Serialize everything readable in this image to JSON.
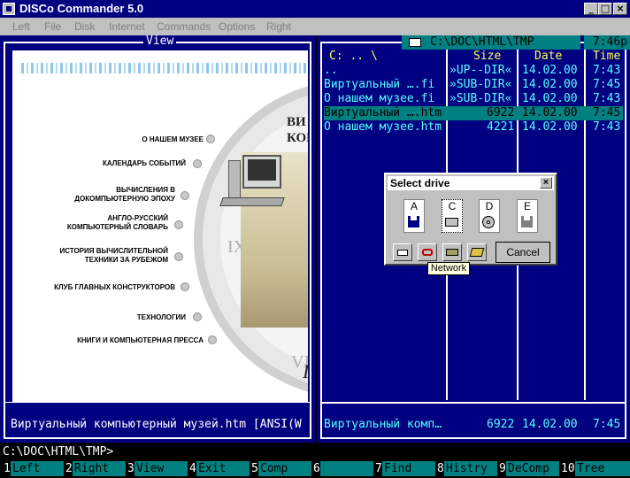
{
  "window": {
    "title": "DISCo Commander 5.0",
    "min": "_",
    "max": "□",
    "close": "×"
  },
  "menu": [
    "Left",
    "File",
    "Disk",
    "Internet",
    "Commands",
    "Options",
    "Right"
  ],
  "left_panel": {
    "title": "View",
    "status": "Виртуальный компьютерный музей.htm [ANSI(W",
    "page": {
      "heading_partial": [
        "ВИ",
        "КОМ"
      ],
      "links": [
        "О НАШЕМ МУЗЕЕ",
        "КАЛЕНДАРЬ СОБЫТИЙ",
        "ВЫЧИСЛЕНИЯ В\nДОКОМПЬЮТЕРНУЮ ЭПОХУ",
        "АНГЛО-РУССКИЙ\nКОМПЬЮТЕРНЫЙ СЛОВАРЬ",
        "ИСТОРИЯ ВЫЧИСЛИТЕЛЬНОЙ\nТЕХНИКИ ЗА РУБЕЖОМ",
        "КЛУБ ГЛАВНЫХ КОНСТРУКТОРОВ",
        "ТЕХНОЛОГИИ",
        "КНИГИ И КОМПЬЮТЕРНАЯ ПРЕССА"
      ]
    }
  },
  "right_panel": {
    "path": "C:\\DOC\\HTML\\TMP",
    "clock": "7:46p",
    "columns": {
      "name": "C: .. \\",
      "size": "Size",
      "date": "Date",
      "time": "Time"
    },
    "files": [
      {
        "name": "..",
        "size": "»UP--DIR«",
        "date": "14.02.00",
        "time": "7:43"
      },
      {
        "name": "Виртуальный ….fi",
        "size": "»SUB-DIR«",
        "date": "14.02.00",
        "time": "7:45"
      },
      {
        "name": "О нашем музее.fi",
        "size": "»SUB-DIR«",
        "date": "14.02.00",
        "time": "7:43"
      },
      {
        "name": "Виртуальный ….htm",
        "size": "6922",
        "date": "14.02.00",
        "time": "7:45"
      },
      {
        "name": "О нашем музее.htm",
        "size": "4221",
        "date": "14.02.00",
        "time": "7:43"
      }
    ],
    "selected_index": 3,
    "status": {
      "name": "Виртуальный комп…",
      "size": "6922",
      "date": "14.02.00",
      "time": "7:45"
    }
  },
  "command_line": "C:\\DOC\\HTML\\TMP>",
  "fkeys": [
    {
      "num": "1",
      "label": "Left"
    },
    {
      "num": "2",
      "label": "Right"
    },
    {
      "num": "3",
      "label": "View"
    },
    {
      "num": "4",
      "label": "Exit"
    },
    {
      "num": "5",
      "label": "Comp"
    },
    {
      "num": "6",
      "label": ""
    },
    {
      "num": "7",
      "label": "Find"
    },
    {
      "num": "8",
      "label": "Histry"
    },
    {
      "num": "9",
      "label": "DeComp"
    },
    {
      "num": "10",
      "label": "Tree"
    }
  ],
  "dialog": {
    "title": "Select drive",
    "close": "×",
    "drives": [
      "A",
      "C",
      "D",
      "E"
    ],
    "cancel": "Cancel",
    "tooltip": "Network"
  },
  "colors": {
    "panel": "#000080",
    "file_text": "#55ffff",
    "highlight": "#008080",
    "dialog": "#c0c0c0"
  }
}
